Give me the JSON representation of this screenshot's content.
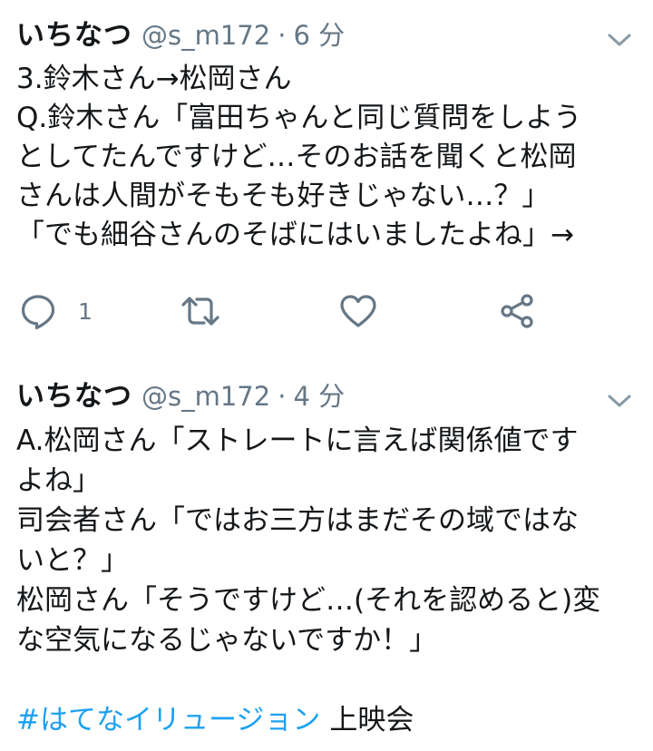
{
  "tweets": [
    {
      "display_name": "いちなつ",
      "handle": "@s_m172",
      "separator": "·",
      "time": "6 分",
      "lines": [
        "3.鈴木さん→松岡さん",
        "Q.鈴木さん「富田ちゃんと同じ質問をしよう",
        "としてたんですけど…そのお話を聞くと松岡",
        "さんは人間がそもそも好きじゃない…？」",
        "「でも細谷さんのそばにはいましたよね」→"
      ],
      "reply_count": "1",
      "icons": {
        "reply": "reply-icon",
        "retweet": "retweet-icon",
        "like": "heart-icon",
        "share": "share-icon",
        "menu": "chevron-down-icon"
      }
    },
    {
      "display_name": "いちなつ",
      "handle": "@s_m172",
      "separator": "·",
      "time": "4 分",
      "lines": [
        "A.松岡さん「ストレートに言えば関係値です",
        "よね」",
        "司会者さん「ではお三方はまだその域ではな",
        "いと？」",
        "松岡さん「そうですけど…(それを認めると)変",
        "な空気になるじゃないですか！」"
      ],
      "hashtag": "#はてなイリュージョン",
      "hashtag_suffix": "上映会"
    }
  ],
  "colors": {
    "text": "#14171a",
    "secondary": "#657786",
    "link": "#1da1f2"
  }
}
